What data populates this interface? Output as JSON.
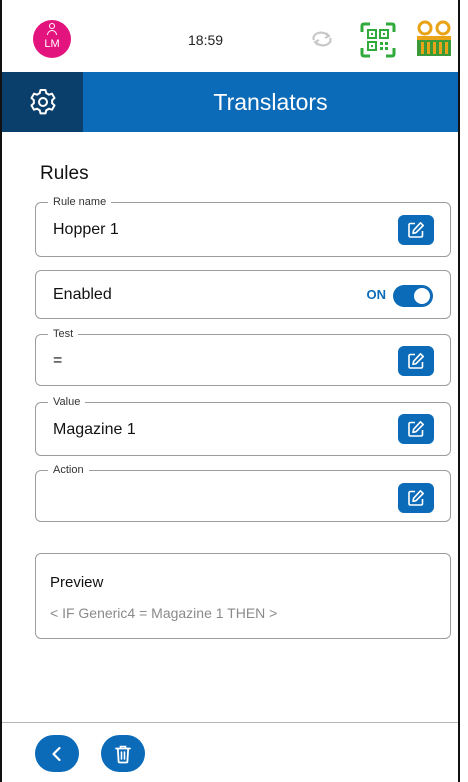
{
  "status_bar": {
    "avatar_initials": "LM",
    "time": "18:59",
    "icons": [
      "sync-icon",
      "qr-code-icon",
      "edge-device-icon"
    ]
  },
  "header": {
    "title": "Translators",
    "left_icon": "gear-icon"
  },
  "rules": {
    "section_title": "Rules",
    "rule_name": {
      "label": "Rule name",
      "value": "Hopper 1"
    },
    "enabled": {
      "label": "Enabled",
      "state_text": "ON",
      "on": true
    },
    "test": {
      "label": "Test",
      "value": "="
    },
    "value": {
      "label": "Value",
      "value": "Magazine 1"
    },
    "action": {
      "label": "Action",
      "value": ""
    }
  },
  "preview": {
    "title": "Preview",
    "text": "< IF Generic4 = Magazine 1 THEN >"
  },
  "footer": {
    "buttons": [
      "back-icon",
      "trash-icon"
    ]
  },
  "colors": {
    "primary": "#0b6bb8",
    "header_dark": "#0a3f6b",
    "avatar": "#e4147e",
    "qr_green": "#2faa3b",
    "device_orange": "#e8a317"
  }
}
